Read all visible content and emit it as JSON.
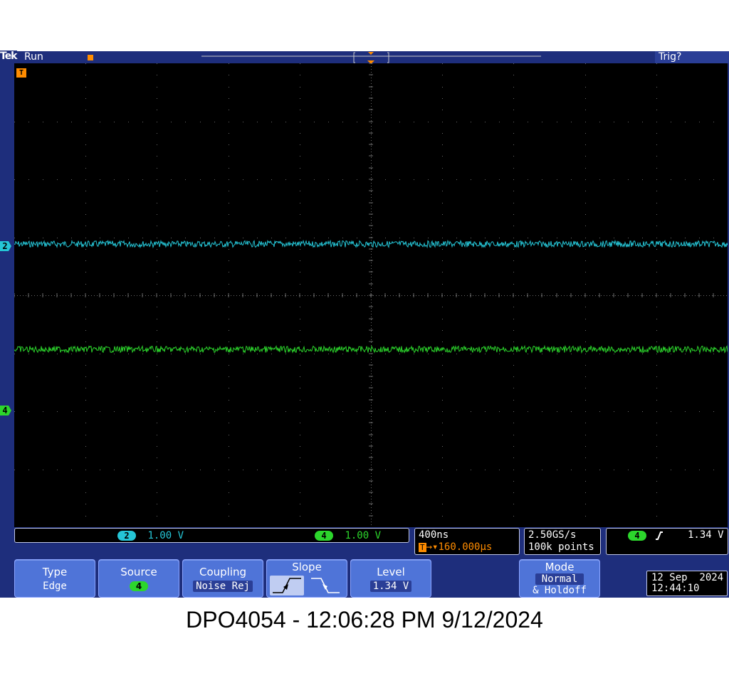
{
  "top": {
    "brand": "Tek",
    "run_state": "Run",
    "trigger_status": "Trig?"
  },
  "markers": {
    "trigger": "T",
    "ch2": "2",
    "ch4": "4"
  },
  "channels": [
    {
      "num": "2",
      "scale": "1.00 V",
      "color": "#25c5d6"
    },
    {
      "num": "4",
      "scale": "1.00 V",
      "color": "#2cd62c"
    }
  ],
  "timebase": {
    "time_per_div": "400ns",
    "trigger_position": "160.000µs",
    "trig_icon": "T",
    "sample_rate": "2.50GS/s",
    "record_length": "100k points"
  },
  "trigger_readout": {
    "source": "4",
    "slope_icon": "rising-edge-icon",
    "level": "1.34 V"
  },
  "menu": {
    "type": {
      "label": "Type",
      "value": "Edge"
    },
    "source": {
      "label": "Source",
      "value": "4"
    },
    "coupling": {
      "label": "Coupling",
      "value": "Noise Rej"
    },
    "slope": {
      "label": "Slope",
      "selected": "rising"
    },
    "level": {
      "label": "Level",
      "value": "1.34 V"
    },
    "mode": {
      "label": "Mode",
      "value": "Normal",
      "value2": "& Holdoff"
    }
  },
  "clock": {
    "date": "12 Sep  2024",
    "time": "12:44:10"
  },
  "caption": "DPO4054 - 12:06:28 PM   9/12/2024",
  "colors": {
    "frame": "#1e2e7c",
    "button": "#4f74d8",
    "ch2": "#25c5d6",
    "ch4": "#2cd62c",
    "trigger": "#ff8c00"
  }
}
